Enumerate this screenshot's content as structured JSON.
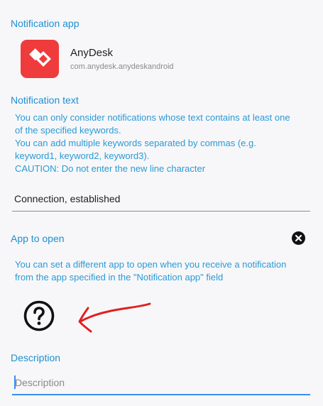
{
  "notification_app": {
    "title": "Notification app",
    "app_name": "AnyDesk",
    "package": "com.anydesk.anydeskandroid",
    "icon": "anydesk-logo"
  },
  "notification_text": {
    "title": "Notification text",
    "hint_lines": [
      "You can only consider notifications whose text contains at least one",
      "of the specified keywords.",
      "You can add multiple keywords separated by commas (e.g.",
      "keyword1, keyword2, keyword3).",
      "CAUTION: Do not enter the new line character"
    ],
    "value": "Connection, established"
  },
  "app_to_open": {
    "title": "App to open",
    "hint_lines": [
      "You can set a different app to open when you receive a notification",
      "from the app specified in the \"Notification app\" field"
    ],
    "clear_icon": "close-circle-icon",
    "app_icon": "question-mark-circle-icon"
  },
  "description": {
    "title": "Description",
    "placeholder": "Description",
    "value": ""
  },
  "colors": {
    "accent": "#1e8fd0",
    "hint": "#2a9ad6",
    "brand": "#ef3b3b",
    "annotation": "#e02020",
    "focus_underline": "#3a8ef0"
  }
}
